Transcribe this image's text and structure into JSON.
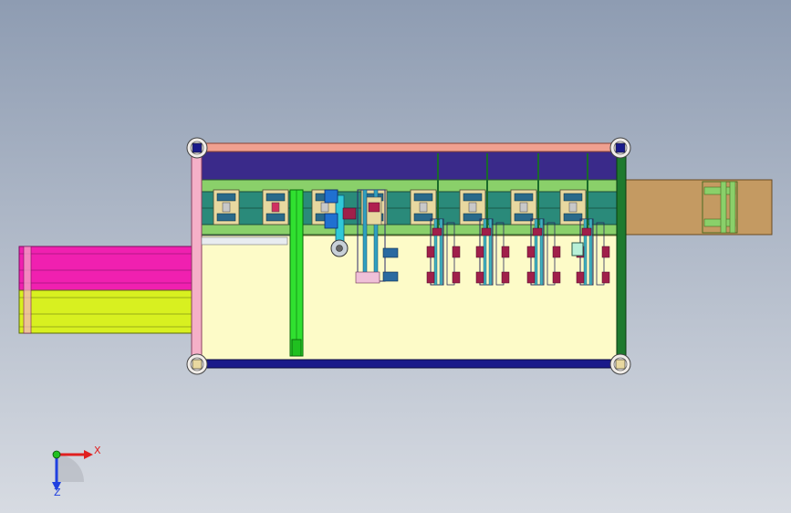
{
  "viewport": {
    "background_top": "#8e9cb2",
    "background_bottom": "#d7dbe2"
  },
  "triad": {
    "x_label": "X",
    "z_label": "Z",
    "x_color": "#e02020",
    "y_color": "#20c020",
    "z_color": "#2040e0"
  },
  "colors": {
    "frame_salmon": "#f0a090",
    "frame_pink": "#f5b0c8",
    "frame_green": "#1e7a2e",
    "frame_navy": "#1a1a8a",
    "top_band_purple": "#3a2a8a",
    "conveyor_teal": "#2a8a7a",
    "conveyor_green": "#8ad06a",
    "table_cream": "#fdfbc8",
    "infeed_magenta": "#f020b0",
    "infeed_yellow": "#d8f020",
    "outfeed_brown": "#c49a62",
    "column_green": "#30e030",
    "cylinder_blue": "#2070d0",
    "cylinder_cyan": "#30c8d8",
    "clamp_maroon": "#a0204a",
    "gripper_beige": "#e8d8a0"
  }
}
